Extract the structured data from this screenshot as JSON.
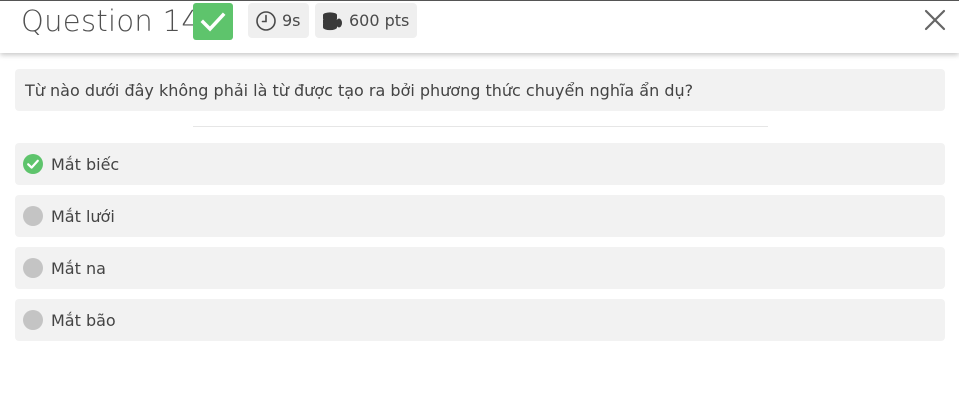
{
  "header": {
    "title": "Question 14",
    "time": "9s",
    "points": "600 pts",
    "correct_color": "#5ec46c"
  },
  "question": {
    "text": "Từ nào dưới đây không phải là từ được tạo ra bởi phương thức chuyển nghĩa ẩn dụ?"
  },
  "options": [
    {
      "label": "Mắt biếc",
      "state": "correct"
    },
    {
      "label": "Mắt lưới",
      "state": "unselected"
    },
    {
      "label": "Mắt na",
      "state": "unselected"
    },
    {
      "label": "Mắt bão",
      "state": "unselected"
    }
  ],
  "icons": {
    "badge": "check-icon",
    "time": "clock-icon",
    "points": "coins-icon",
    "close": "close-icon"
  }
}
